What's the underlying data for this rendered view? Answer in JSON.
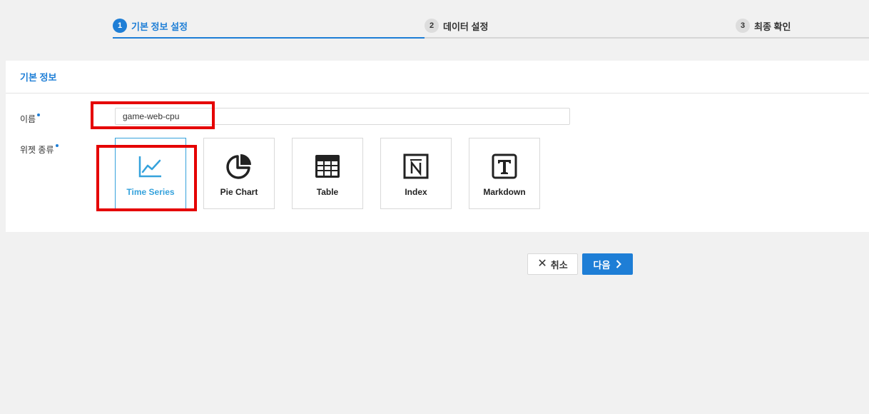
{
  "stepper": {
    "steps": [
      {
        "num": "1",
        "label": "기본 정보 설정",
        "active": true
      },
      {
        "num": "2",
        "label": "데이터 설정",
        "active": false
      },
      {
        "num": "3",
        "label": "최종 확인",
        "active": false
      }
    ]
  },
  "panel": {
    "title": "기본 정보",
    "name_label": "이름",
    "name_value": "game-web-cpu",
    "widget_type_label": "위젯 종류",
    "widgets": [
      {
        "label": "Time Series",
        "icon": "line-chart-icon",
        "selected": true
      },
      {
        "label": "Pie Chart",
        "icon": "pie-chart-icon",
        "selected": false
      },
      {
        "label": "Table",
        "icon": "table-icon",
        "selected": false
      },
      {
        "label": "Index",
        "icon": "index-icon",
        "selected": false
      },
      {
        "label": "Markdown",
        "icon": "markdown-icon",
        "selected": false
      }
    ]
  },
  "actions": {
    "cancel_label": "취소",
    "next_label": "다음"
  },
  "colors": {
    "accent": "#1e7ed6",
    "selected_widget": "#35a2dc",
    "highlight": "#e50000",
    "background": "#f1f1f1"
  }
}
